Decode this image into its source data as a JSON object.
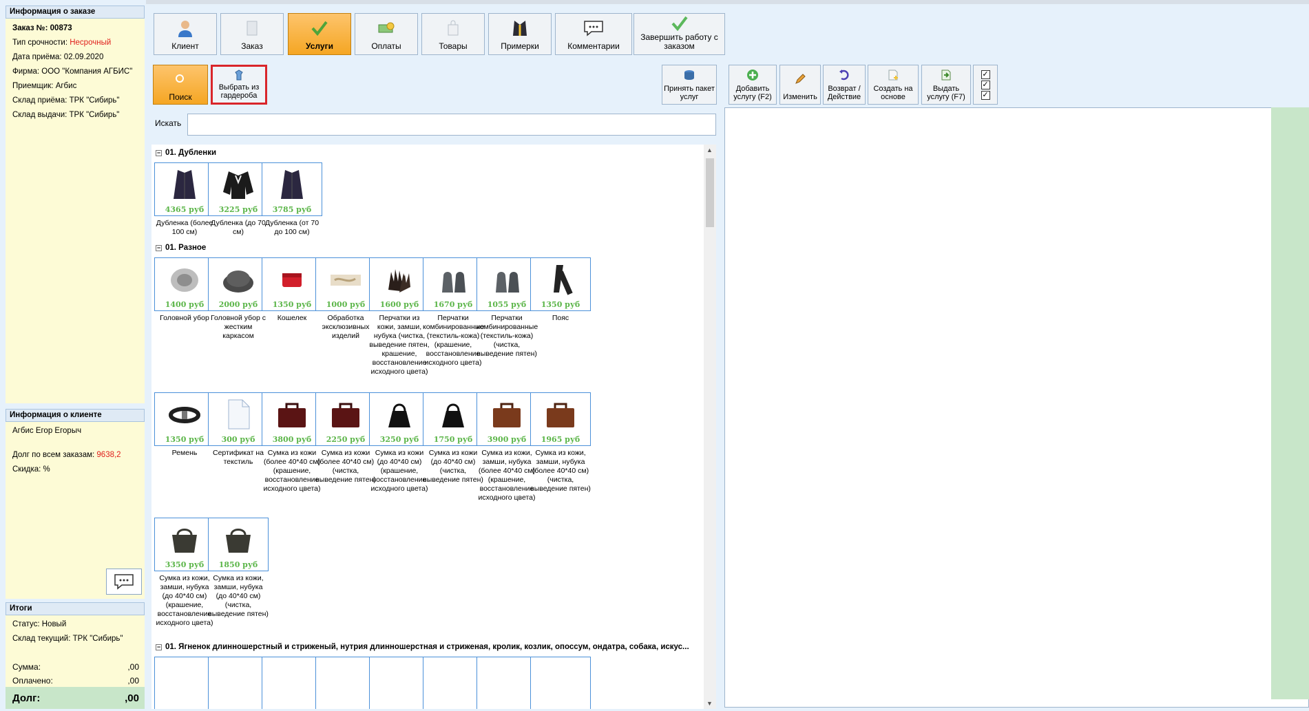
{
  "order_info": {
    "header": "Информация о заказе",
    "number": "Заказ №: 00873",
    "urgency_label": "Тип срочности:",
    "urgency_value": "Несрочный",
    "date": "Дата приёма: 02.09.2020",
    "firm": "Фирма: ООО \"Компания АГБИС\"",
    "receiver": "Приемщик: Агбис",
    "warehouse_in": "Склад приёма: ТРК \"Сибирь\"",
    "warehouse_out": "Склад выдачи: ТРК \"Сибирь\""
  },
  "client_info": {
    "header": "Информация о клиенте",
    "name": "Агбис Егор Егорыч",
    "debt_label": "Долг по всем заказам:",
    "debt_value": "9638,2",
    "discount": "Скидка: %"
  },
  "totals": {
    "header": "Итоги",
    "status": "Статус: Новый",
    "warehouse": "Склад текущий: ТРК \"Сибирь\"",
    "sum_label": "Сумма:",
    "sum_value": ",00",
    "paid_label": "Оплачено:",
    "paid_value": ",00",
    "debt_label": "Долг:",
    "debt_value": ",00"
  },
  "toolbar": {
    "client": "Клиент",
    "order": "Заказ",
    "services": "Услуги",
    "payments": "Оплаты",
    "goods": "Товары",
    "fittings": "Примерки",
    "comments": "Комментарии",
    "finish": "Завершить работу с заказом"
  },
  "toolbar2": {
    "search": "Поиск",
    "wardrobe": "Выбрать из гардероба",
    "accept_package": "Принять пакет услуг",
    "add_service": "Добавить услугу (F2)",
    "edit": "Изменить",
    "return_action": "Возврат / Действие",
    "create_based": "Создать на основе",
    "issue_service": "Выдать услугу (F7)"
  },
  "search": {
    "label": "Искать",
    "value": ""
  },
  "categories": [
    {
      "title": "01. Дубленки",
      "items": [
        {
          "price": "4365 руб",
          "label": "Дубленка (более 100 см)",
          "icon": "coat-icon"
        },
        {
          "price": "3225 руб",
          "label": "Дубленка (до 70 см)",
          "icon": "jacket-icon"
        },
        {
          "price": "3785 руб",
          "label": "Дубленка (от 70 до 100 см)",
          "icon": "coat-icon"
        }
      ]
    },
    {
      "title": "01. Разное",
      "items": [
        {
          "price": "1400 руб",
          "label": "Головной убор",
          "icon": "hat-icon"
        },
        {
          "price": "2000 руб",
          "label": "Головной убор с жестким каркасом",
          "icon": "cap-icon"
        },
        {
          "price": "1350 руб",
          "label": "Кошелек",
          "icon": "wallet-icon"
        },
        {
          "price": "1000 руб",
          "label": "Обработка эксклюзивных изделий",
          "icon": "fur-icon"
        },
        {
          "price": "1600 руб",
          "label": "Перчатки из кожи, замши, нубука (чистка, выведение пятен, крашение, восстановление исходного цвета)",
          "icon": "gloves-icon"
        },
        {
          "price": "1670 руб",
          "label": "Перчатки комбинированные (текстиль-кожа) (крашение, восстановление исходного цвета)",
          "icon": "mittens-icon"
        },
        {
          "price": "1055 руб",
          "label": "Перчатки комбинированные (текстиль-кожа) (чистка, выведение пятен)",
          "icon": "mittens-icon"
        },
        {
          "price": "1350 руб",
          "label": "Пояс",
          "icon": "belt-icon"
        },
        {
          "price": "1350 руб",
          "label": "Ремень",
          "icon": "strap-icon"
        },
        {
          "price": "300 руб",
          "label": "Сертификат на текстиль",
          "icon": "document-icon"
        },
        {
          "price": "3800 руб",
          "label": "Сумка из кожи (более 40*40 см) (крашение, восстановление исходного цвета)",
          "icon": "briefcase-icon"
        },
        {
          "price": "2250 руб",
          "label": "Сумка из кожи (более 40*40 см) (чистка, выведение пятен)",
          "icon": "briefcase-icon"
        },
        {
          "price": "3250 руб",
          "label": "Сумка из кожи (до 40*40 см) (крашение, восстановление исходного цвета)",
          "icon": "handbag-icon"
        },
        {
          "price": "1750 руб",
          "label": "Сумка из кожи (до 40*40 см) (чистка, выведение пятен)",
          "icon": "handbag-icon"
        },
        {
          "price": "3900 руб",
          "label": "Сумка из кожи, замши, нубука (более 40*40 см) (крашение, восстановление исходного цвета)",
          "icon": "brown-briefcase-icon"
        },
        {
          "price": "1965 руб",
          "label": "Сумка из кожи, замши, нубука (более 40*40 см) (чистка, выведение пятен)",
          "icon": "brown-briefcase-icon"
        },
        {
          "price": "3350 руб",
          "label": "Сумка из кожи, замши, нубука (до 40*40 см) (крашение, восстановление исходного цвета)",
          "icon": "pouch-icon"
        },
        {
          "price": "1850 руб",
          "label": "Сумка из кожи, замши, нубука (до 40*40 см) (чистка, выведение пятен)",
          "icon": "pouch-icon"
        }
      ]
    },
    {
      "title": "01. Ягненок длинношерстный и стриженый, нутрия длинношерстная и стриженая, кролик, козлик, опоссум, ондатра, собака, искус...",
      "items": []
    }
  ],
  "colors": {
    "accent": "#f5a623",
    "price": "#5bb548",
    "panel": "#fdfbd6",
    "debt_bg": "#c8e6c9",
    "alert": "#e0201c"
  }
}
